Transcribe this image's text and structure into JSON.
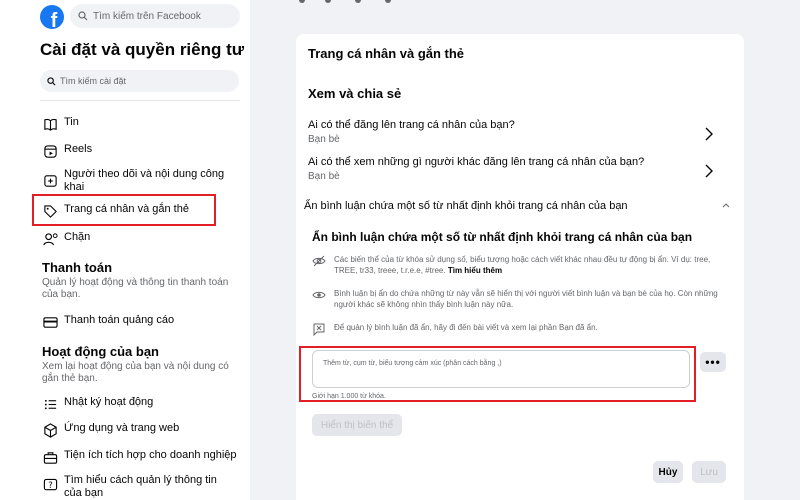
{
  "header": {
    "search_placeholder": "Tìm kiếm trên Facebook",
    "brand_color": "#1877f2"
  },
  "sidebar": {
    "title": "Cài đặt và quyền riêng tư",
    "search_placeholder": "Tìm kiếm cài đặt",
    "items": [
      {
        "label": "Tin",
        "icon": "book-icon"
      },
      {
        "label": "Reels",
        "icon": "reels-icon"
      },
      {
        "label": "Người theo dõi và nội dung công khai",
        "icon": "public-post-icon"
      },
      {
        "label": "Trang cá nhân và gắn thẻ",
        "icon": "tag-icon",
        "highlighted": true
      },
      {
        "label": "Chặn",
        "icon": "block-user-icon"
      }
    ],
    "payments": {
      "title": "Thanh toán",
      "desc": "Quản lý hoạt động và thông tin thanh toán của bạn.",
      "items": [
        {
          "label": "Thanh toán quảng cáo",
          "icon": "card-icon"
        }
      ]
    },
    "activity": {
      "title": "Hoạt động của bạn",
      "desc": "Xem lại hoạt động của bạn và nội dung có gắn thẻ bạn.",
      "items": [
        {
          "label": "Nhật ký hoạt động",
          "icon": "list-icon"
        },
        {
          "label": "Ứng dụng và trang web",
          "icon": "cube-icon"
        },
        {
          "label": "Tiện ích tích hợp cho doanh nghiệp",
          "icon": "briefcase-icon"
        },
        {
          "label": "Tìm hiểu cách quản lý thông tin của bạn",
          "icon": "help-icon"
        }
      ]
    }
  },
  "main": {
    "title": "Trang cá nhân và gắn thẻ",
    "section": "Xem và chia sẻ",
    "rows": [
      {
        "question": "Ai có thể đăng lên trang cá nhân của bạn?",
        "answer": "Bạn bè"
      },
      {
        "question": "Ai có thể xem những gì người khác đăng lên trang cá nhân của bạn?",
        "answer": "Bạn bè"
      }
    ],
    "hide_comments_header": "Ẩn bình luận chứa một số từ nhất định khỏi trang cá nhân của bạn",
    "hide_comments_title": "Ẩn bình luận chứa một số từ nhất định khỏi trang cá nhân của bạn",
    "info": [
      {
        "text": "Các biến thể của từ khóa sử dụng số, biểu tượng hoặc cách viết khác nhau đều tự động bị ẩn. Ví dụ: tree, TREE, tr33, treee, t.r.e.e, #tree.",
        "link": "Tìm hiểu thêm",
        "icon": "eye-slash-icon"
      },
      {
        "text": "Bình luận bị ẩn do chứa những từ này vẫn sẽ hiển thị với người viết bình luận và bạn bè của họ. Còn những người khác sẽ không nhìn thấy bình luận này nữa.",
        "icon": "eye-icon"
      },
      {
        "text": "Để quản lý bình luận đã ẩn, hãy đi đến bài viết và xem lại phần Bạn đã ẩn.",
        "icon": "comment-hidden-icon"
      }
    ],
    "keyword_placeholder": "Thêm từ, cụm từ, biểu tượng cảm xúc (phân cách bằng ,)",
    "more_label": "•••",
    "limit_text": "Giới hạn 1.000 từ khóa.",
    "show_button": "Hiển thị biến thể",
    "cancel_button": "Hủy",
    "save_button": "Lưu"
  }
}
